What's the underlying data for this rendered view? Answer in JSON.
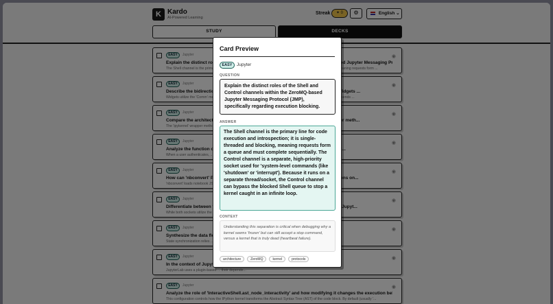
{
  "header": {
    "logo_letter": "K",
    "app_name": "Kardo",
    "app_subtitle": "AI-Powered Learning",
    "streak_label": "Streak",
    "streak_value": "0",
    "settings_icon": "gear-icon",
    "language": "English"
  },
  "tabs": [
    {
      "label": "STUDY",
      "active": false
    },
    {
      "label": "DECKS",
      "active": true
    }
  ],
  "cards": [
    {
      "difficulty": "EASY",
      "deck": "Jupyter",
      "question": "Explain the distinct roles of the Shell and Control channels within the ZeroMQ-based Jupyter Messaging Protocol...",
      "answer_preview": "The Shell channel is the primary line for code execution and introspection; it is single-threaded and blocking, meaning requests form ..."
    },
    {
      "difficulty": "EASY",
      "deck": "Jupyter",
      "question": "Describe the bidirectional communication mechanism between interactive HTML Widgets ...",
      "answer_preview": "Widgets utilize the 'Comm' messaging system ... When the user interacts with the frontend changes, the kernel sends ..."
    },
    {
      "difficulty": "EASY",
      "deck": "Jupyter",
      "question": "Compare the architecture of the standard IPython kernel and the 'ipykernel' wrapper meth...",
      "answer_preview": "The 'ipykernel' wrapper method allows developers ... but binds the kernel to ..."
    },
    {
      "difficulty": "EASY",
      "deck": "Jupyter",
      "question": "Analyze the function of the Jupyter Server's authentication layer focusing on the bi...",
      "answer_preview": "When a user authenticates, ... the kernel automatically provisions a ..."
    },
    {
      "difficulty": "EASY",
      "deck": "Jupyter",
      "question": "How can 'nbconvert' Preprocessors be used to apply programmatic cell modifications on...",
      "answer_preview": "'nbconvert' loads notebook JSON ... 'nbconvert' preprocessors Preprocess ..."
    },
    {
      "difficulty": "EASY",
      "deck": "Jupyter",
      "question": "Differentiate between the security model of a single-user ... and the ZeroMQ-based Jupyt...",
      "answer_preview": "While both sockets utilize the ... the kernel handles the main execution ..."
    },
    {
      "difficulty": "EASY",
      "deck": "Jupyter",
      "question": "Synthesize the data flow of the JupyterLab ... specifically focusing on ...",
      "answer_preview": "State synchronization relies ... the state delta. The ..."
    },
    {
      "difficulty": "EASY",
      "deck": "Jupyter",
      "question": "In the context of JupyterLab's ... extension pattern provided by the ...",
      "answer_preview": "JupyterLab uses a plugin-based ... their depende..."
    },
    {
      "difficulty": "EASY",
      "deck": "Jupyter",
      "question": "Analyze the role of 'InteractiveShell.ast_node_interactivity' and how modifying it changes the execution beh...",
      "answer_preview": "This configuration controls how the IPython kernel transforms the Abstract Syntax Tree (AST) of the code block. By default (usually '..."
    }
  ],
  "modal": {
    "title": "Card Preview",
    "difficulty": "EASY",
    "deck": "Jupyter",
    "question_label": "QUESTION",
    "question": "Explain the distinct roles of the Shell and Control channels within the ZeroMQ-based Jupyter Messaging Protocol (JMP), specifically regarding execution blocking.",
    "answer_label": "ANSWER",
    "answer": "The Shell channel is the primary line for code execution and introspection; it is single-threaded and blocking, meaning requests form a queue and must complete sequentially. The Control channel is a separate, high-priority socket used for 'system-level commands (like 'shutdown' or 'interrupt'). Because it runs on a separate thread/socket, the Control channel can bypass the blocked Shell queue to stop a kernel caught in an infinite loop.",
    "context_label": "CONTEXT",
    "context": "Understanding this separation is critical when debugging why a kernel seems 'frozen' but can still accept a stop command, versus a kernel that is truly dead (heartbeat failure).",
    "tags": [
      "architecture",
      "ZeroMQ",
      "kernel",
      "protocols"
    ]
  },
  "colors": {
    "accent_teal": "#4aa796",
    "pill_bg": "#cfeee8",
    "streak_yellow": "#f3c64a",
    "dark": "#111111"
  }
}
